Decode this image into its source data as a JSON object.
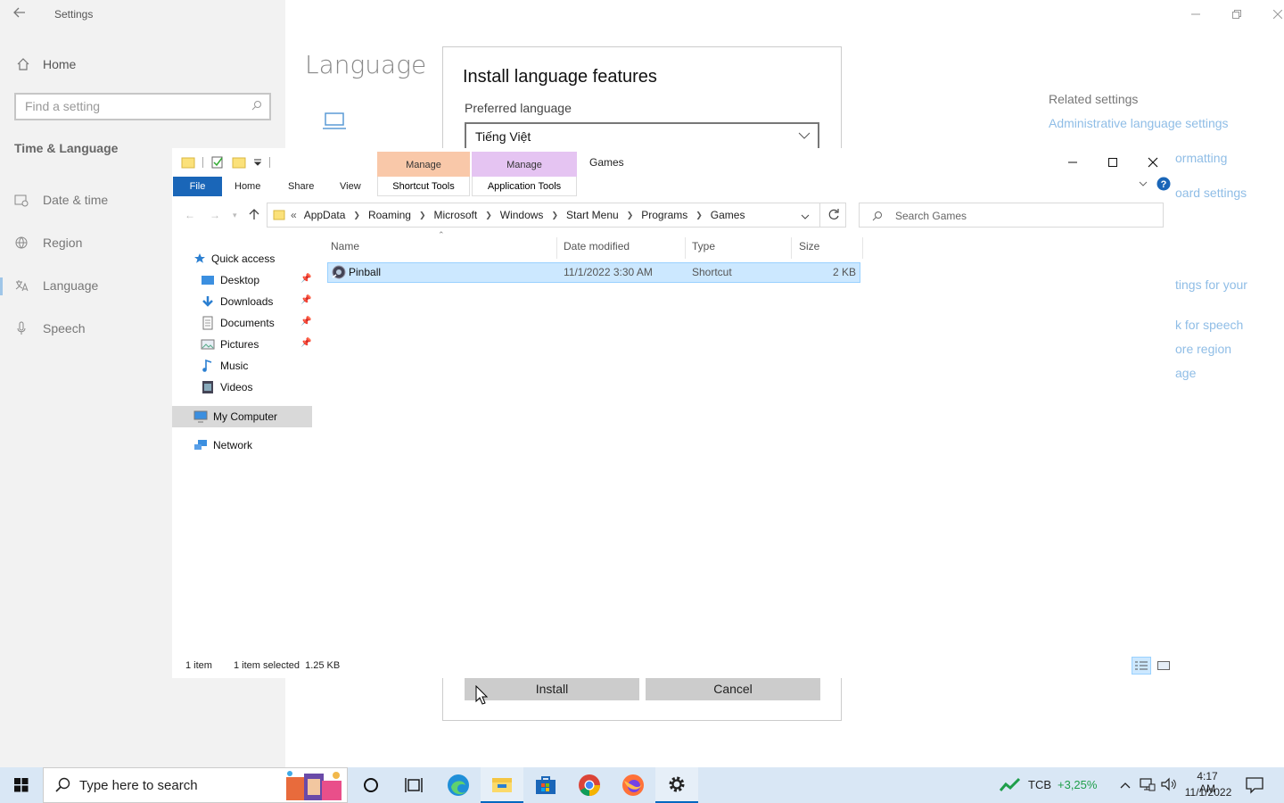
{
  "settings": {
    "window_title": "Settings",
    "home": "Home",
    "search_placeholder": "Find a setting",
    "section": "Time & Language",
    "nav": [
      "Date & time",
      "Region",
      "Language",
      "Speech"
    ],
    "page_title": "Language",
    "related_title": "Related settings",
    "related_links": [
      "Administrative language settings",
      "ormatting",
      "oard settings",
      "tings for your",
      "k for speech",
      "ore region",
      "age"
    ]
  },
  "dialog": {
    "title": "Install language features",
    "preferred_label": "Preferred language",
    "selected_language": "Tiếng Việt",
    "install": "Install",
    "cancel": "Cancel"
  },
  "explorer": {
    "title": "Games",
    "context_tabs": [
      {
        "header": "Manage",
        "sub": "Shortcut Tools",
        "color": "#f9c8a9"
      },
      {
        "header": "Manage",
        "sub": "Application Tools",
        "color": "#e5c4f2"
      }
    ],
    "ribbon_tabs": [
      "File",
      "Home",
      "Share",
      "View"
    ],
    "breadcrumb": [
      "AppData",
      "Roaming",
      "Microsoft",
      "Windows",
      "Start Menu",
      "Programs",
      "Games"
    ],
    "breadcrumb_prefix": "«",
    "search_placeholder": "Search Games",
    "nav": {
      "quick_access": "Quick access",
      "items": [
        "Desktop",
        "Downloads",
        "Documents",
        "Pictures",
        "Music",
        "Videos"
      ],
      "my_computer": "My Computer",
      "network": "Network"
    },
    "columns": [
      "Name",
      "Date modified",
      "Type",
      "Size"
    ],
    "files": [
      {
        "name": "Pinball",
        "date": "11/1/2022 3:30 AM",
        "type": "Shortcut",
        "size": "2 KB"
      }
    ],
    "status_count": "1 item",
    "status_selected": "1 item selected  1.25 KB"
  },
  "taskbar": {
    "search_placeholder": "Type here to search",
    "stock_symbol": "TCB",
    "stock_change": "+3,25%",
    "time": "4:17 AM",
    "date": "11/1/2022"
  },
  "colors": {
    "accent": "#0067c0",
    "selection": "#cce8ff",
    "file_tab": "#1a66b8",
    "stock_up": "#1e9e4a"
  }
}
